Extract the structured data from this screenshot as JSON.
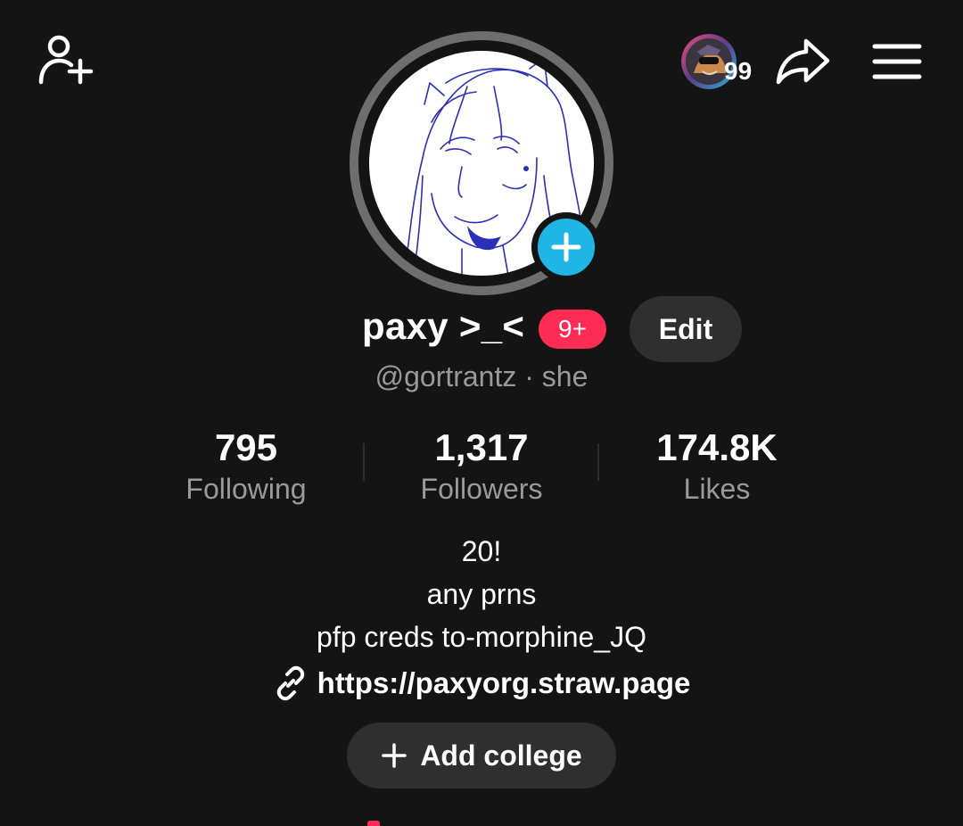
{
  "topbar": {
    "add_friend_icon": "add-friend-icon",
    "story_count": "99",
    "share_icon": "share-icon",
    "menu_icon": "hamburger-menu-icon"
  },
  "profile": {
    "display_name": "paxy >_<",
    "notification_badge": "9+",
    "edit_label": "Edit",
    "handle": "@gortrantz",
    "separator": "·",
    "pronoun": "she"
  },
  "stats": [
    {
      "value": "795",
      "label": "Following"
    },
    {
      "value": "1,317",
      "label": "Followers"
    },
    {
      "value": "174.8K",
      "label": "Likes"
    }
  ],
  "bio": {
    "lines": [
      "20!",
      "any prns",
      "pfp creds to-morphine_JQ"
    ],
    "link": "https://paxyorg.straw.page"
  },
  "add_college_label": "Add college",
  "colors": {
    "background": "#141414",
    "accent_red": "#fe2c55",
    "accent_blue": "#1fb6e6",
    "muted_text": "#9a9a9a",
    "button_bg": "#2f2f2f"
  }
}
